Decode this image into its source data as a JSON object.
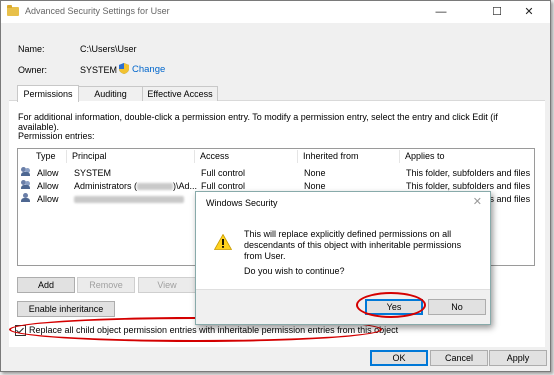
{
  "window": {
    "title": "Advanced Security Settings for User",
    "minimize": "—",
    "maximize": "☐",
    "close": "✕"
  },
  "name_label": "Name:",
  "name_value": "C:\\Users\\User",
  "owner_label": "Owner:",
  "owner_value": "SYSTEM",
  "change_link": "Change",
  "tabs": [
    {
      "label": "Permissions"
    },
    {
      "label": "Auditing"
    },
    {
      "label": "Effective Access"
    }
  ],
  "info_text": "For additional information, double-click a permission entry. To modify a permission entry, select the entry and click Edit (if available).",
  "entries_label": "Permission entries:",
  "columns": [
    "Type",
    "Principal",
    "Access",
    "Inherited from",
    "Applies to"
  ],
  "rows": [
    {
      "type": "Allow",
      "principal": "SYSTEM",
      "access": "Full control",
      "inherited": "None",
      "applies": "This folder, subfolders and files"
    },
    {
      "type": "Allow",
      "principal": "Administrators (",
      "principal_suffix": ")\\Ad...",
      "access": "Full control",
      "inherited": "None",
      "applies": "This folder, subfolders and files"
    },
    {
      "type": "Allow",
      "principal": "",
      "access": "",
      "inherited": "",
      "applies": "This folder, subfolders and files"
    }
  ],
  "buttons": {
    "add": "Add",
    "remove": "Remove",
    "view": "View",
    "enable_inheritance": "Enable inheritance",
    "ok": "OK",
    "cancel": "Cancel",
    "apply": "Apply"
  },
  "replace_checkbox": {
    "checked": true,
    "label": "Replace all child object permission entries with inheritable permission entries from this object"
  },
  "dialog": {
    "title": "Windows Security",
    "close": "✕",
    "message": "This will replace explicitly defined permissions on all descendants of this object with inheritable permissions from User.",
    "question": "Do you wish to continue?",
    "yes": "Yes",
    "no": "No"
  },
  "colors": {
    "highlight": "#d40000",
    "link": "#0066cc",
    "accent": "#0078d7"
  }
}
